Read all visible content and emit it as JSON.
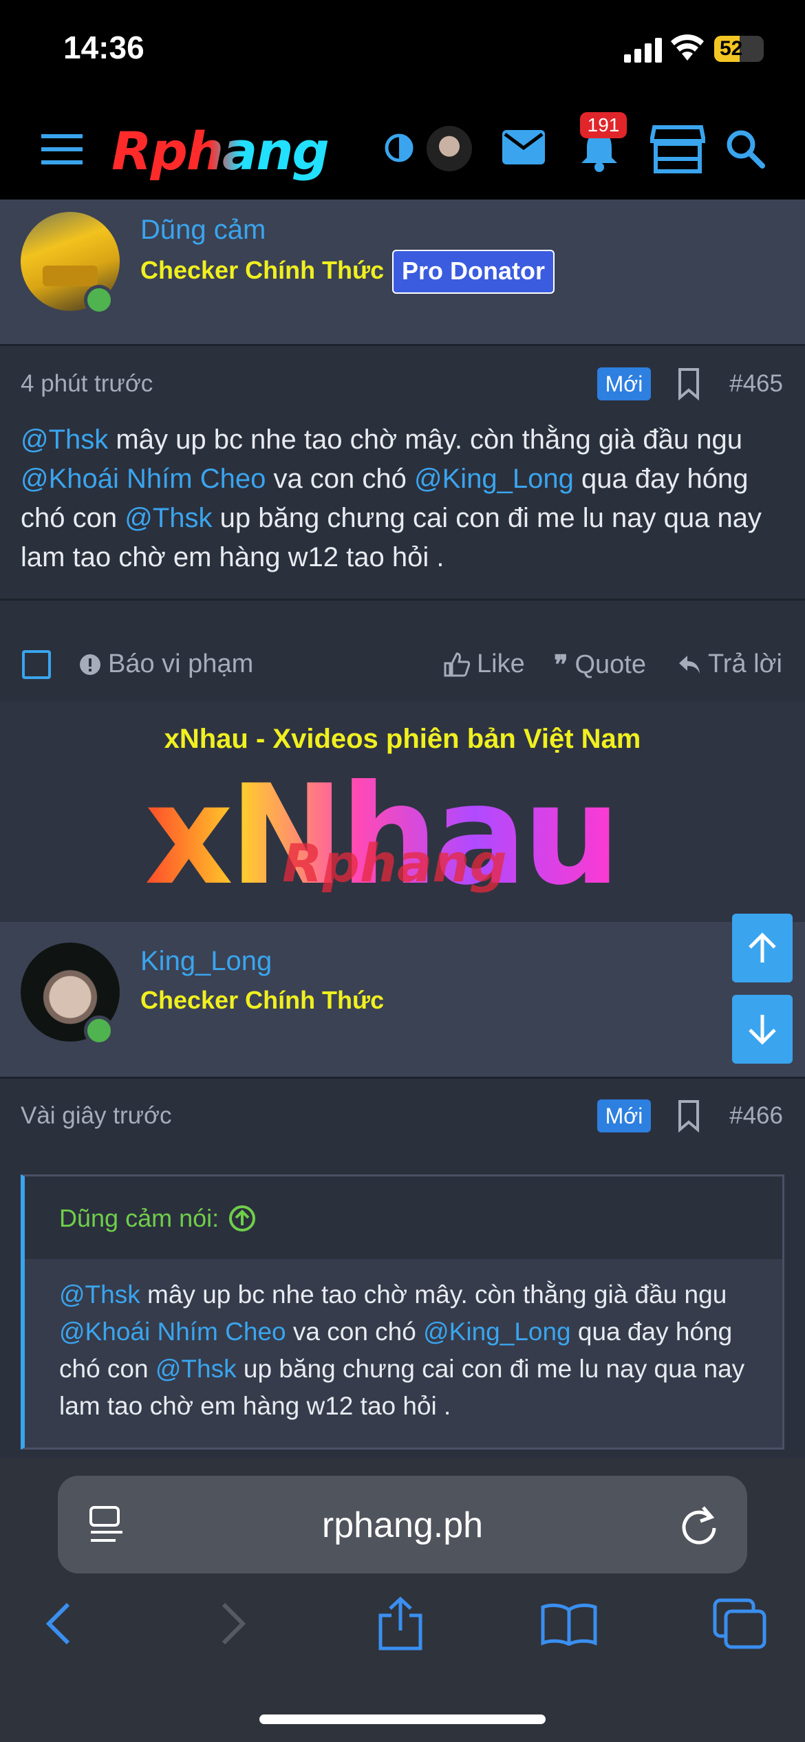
{
  "status_bar": {
    "time": "14:36",
    "battery": "52",
    "battery_level": 0.52
  },
  "nav": {
    "logo": "Rphang",
    "notification_count": "191"
  },
  "post1": {
    "username": "Dũng cảm",
    "user_title": "Checker Chính Thức",
    "badge": "Pro Donator",
    "time": "4 phút trước",
    "new_label": "Mới",
    "post_number": "#465",
    "content": [
      {
        "t": "@Thsk",
        "m": true
      },
      {
        "t": " mây up bc nhe tao chờ mây. còn thằng già đầu ngu ",
        "m": false
      },
      {
        "t": "@Khoái Nhím Cheo",
        "m": true
      },
      {
        "t": " va con chó ",
        "m": false
      },
      {
        "t": "@King_Long",
        "m": true
      },
      {
        "t": " qua đay hóng chó con ",
        "m": false
      },
      {
        "t": "@Thsk",
        "m": true
      },
      {
        "t": " up băng chưng cai con đi me lu nay qua nay lam tao chờ em hàng w12 tao hỏi .",
        "m": false
      }
    ],
    "actions": {
      "report": "Báo vi phạm",
      "like": "Like",
      "quote": "Quote",
      "reply": "Trả lời"
    }
  },
  "ad": {
    "title": "xNhau - Xvideos phiên bản Việt Nam",
    "logo_text": "xNhau",
    "overlay_text": "Rphang"
  },
  "post2": {
    "username": "King_Long",
    "user_title": "Checker Chính Thức",
    "time": "Vài giây trước",
    "new_label": "Mới",
    "post_number": "#466",
    "quote_author": "Dũng cảm nói:",
    "quote_content": [
      {
        "t": "@Thsk",
        "m": true
      },
      {
        "t": " mây up bc nhe tao chờ mây. còn thằng già đầu ngu ",
        "m": false
      },
      {
        "t": "@Khoái Nhím Cheo",
        "m": true
      },
      {
        "t": " va con chó ",
        "m": false
      },
      {
        "t": "@King_Long",
        "m": true
      },
      {
        "t": " qua đay hóng chó con ",
        "m": false
      },
      {
        "t": "@Thsk",
        "m": true
      },
      {
        "t": " up băng chưng cai con đi me lu nay qua nay lam tao chờ em hàng w12 tao hỏi .",
        "m": false
      }
    ]
  },
  "browser": {
    "url": "rphang.ph"
  },
  "colors": {
    "accent": "#3aa5ee",
    "title_yellow": "#f0f020",
    "badge_red": "#e0262b",
    "background": "#2b303d"
  }
}
